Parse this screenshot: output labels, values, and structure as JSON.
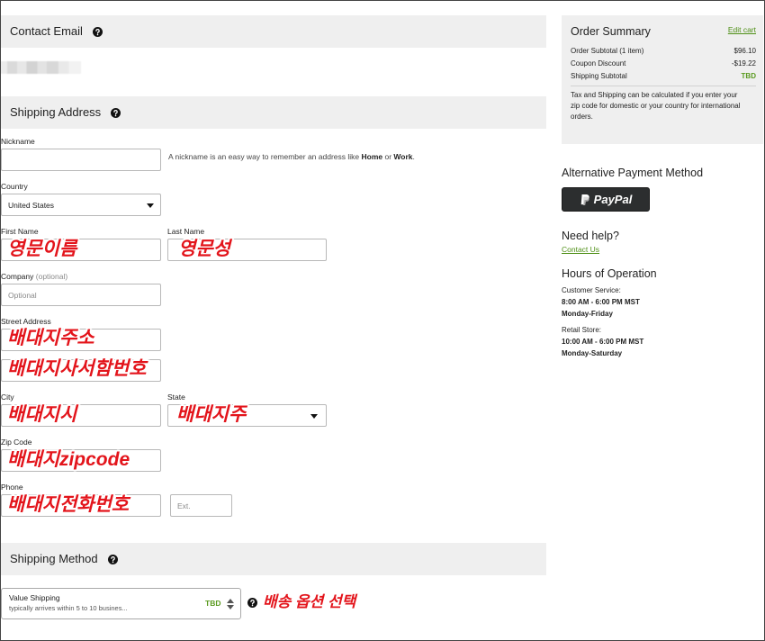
{
  "colors": {
    "section_bg": "#efefef",
    "link_green": "#4e8f16",
    "tbd_green": "#5a9a1f",
    "annotation_red": "#e3141b",
    "paypal_bg": "#2c2e2f"
  },
  "contact": {
    "title": "Contact Email",
    "help_icon": "question-circle-icon"
  },
  "shipping_address": {
    "title": "Shipping Address",
    "help_icon": "question-circle-icon",
    "nickname": {
      "label": "Nickname",
      "hint_start": "A nickname is an easy way to remember an address like ",
      "hint_home": "Home",
      "hint_or": " or ",
      "hint_work": "Work",
      "hint_end": "."
    },
    "country": {
      "label": "Country",
      "value": "United States",
      "icon": "chevron-down-icon"
    },
    "first_name": {
      "label": "First Name",
      "annotation": "영문이름"
    },
    "last_name": {
      "label": "Last Name",
      "annotation": "영문성"
    },
    "company": {
      "label": "Company",
      "optional": "(optional)",
      "placeholder": "Optional"
    },
    "street": {
      "label": "Street Address",
      "annotation_line1": "배대지주소",
      "annotation_line2": "배대지사서함번호"
    },
    "city": {
      "label": "City",
      "annotation": "배대지시"
    },
    "state": {
      "label": "State",
      "annotation": "배대지주",
      "icon": "chevron-down-icon"
    },
    "zip": {
      "label": "Zip Code",
      "annotation": "배대지zipcode"
    },
    "phone": {
      "label": "Phone",
      "annotation": "배대지전화번호",
      "ext_placeholder": "Ext."
    }
  },
  "shipping_method": {
    "title": "Shipping Method",
    "help_icon": "question-circle-icon",
    "option": {
      "name": "Value Shipping",
      "description": "typically arrives within 5 to 10 busines...",
      "price": "TBD",
      "icon": "up-down-arrows-icon"
    },
    "annotation": "배송 옵션 선택"
  },
  "order_summary": {
    "title": "Order Summary",
    "edit_link": "Edit cart",
    "rows": [
      {
        "label": "Order Subtotal (1 item)",
        "value": "$96.10"
      },
      {
        "label": "Coupon Discount",
        "value": "-$19.22"
      },
      {
        "label": "Shipping Subtotal",
        "value": "TBD"
      }
    ],
    "tax_note": [
      "Tax and Shipping can be calculated if you enter your",
      "zip code for domestic or your country for international",
      "orders."
    ]
  },
  "alternative_payment": {
    "title": "Alternative Payment Method",
    "paypal_label": "PayPal",
    "paypal_icon": "paypal-logo-icon"
  },
  "help": {
    "title": "Need help?",
    "contact_link": "Contact Us"
  },
  "hours": {
    "title": "Hours of Operation",
    "customer_service": {
      "label": "Customer Service:",
      "time": "8:00 AM - 6:00 PM MST",
      "days": "Monday-Friday"
    },
    "retail_store": {
      "label": "Retail Store:",
      "time": "10:00 AM - 6:00 PM MST",
      "days": "Monday-Saturday"
    }
  }
}
